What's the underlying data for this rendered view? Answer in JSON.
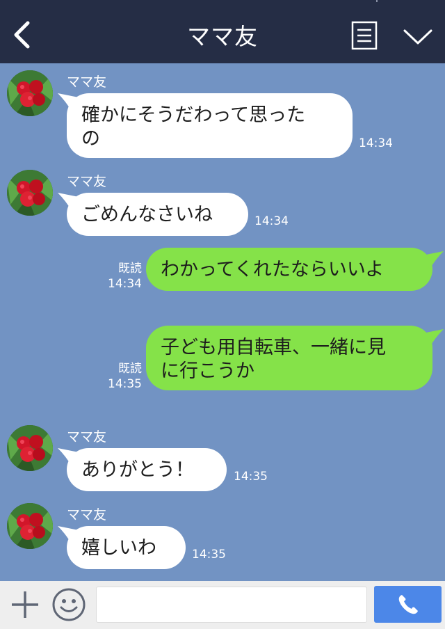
{
  "header": {
    "title": "ママ友"
  },
  "contact": {
    "name": "ママ友"
  },
  "messages": [
    {
      "direction": "incoming",
      "sender": "ママ友",
      "text_lines": [
        "確かにそうだわって思った",
        "の"
      ],
      "time": "14:34"
    },
    {
      "direction": "incoming",
      "sender": "ママ友",
      "text_lines": [
        "ごめんなさいね"
      ],
      "time": "14:34"
    },
    {
      "direction": "outgoing",
      "read_label": "既読",
      "text_lines": [
        "わかってくれたならいいよ"
      ],
      "time": "14:34"
    },
    {
      "direction": "outgoing",
      "read_label": "既読",
      "text_lines": [
        "子ども用自転車、一緒に見",
        "に行こうか"
      ],
      "time": "14:35"
    },
    {
      "direction": "incoming",
      "sender": "ママ友",
      "text_lines": [
        "ありがとう！"
      ],
      "time": "14:35"
    },
    {
      "direction": "incoming",
      "sender": "ママ友",
      "text_lines": [
        "嬉しいわ"
      ],
      "time": "14:35"
    }
  ],
  "composer": {
    "value": "",
    "placeholder": ""
  },
  "icons": {
    "back": "chevron-left-icon",
    "menu": "menu-list-icon",
    "collapse": "chevron-down-icon",
    "add": "plus-icon",
    "emoji": "smiley-icon",
    "call": "phone-icon"
  },
  "colors": {
    "header_bg": "#252d45",
    "chat_bg": "#7293c3",
    "incoming_bubble": "#ffffff",
    "outgoing_bubble": "#85e249",
    "call_button": "#4c87e8",
    "footer_bg": "#eeeeee"
  }
}
